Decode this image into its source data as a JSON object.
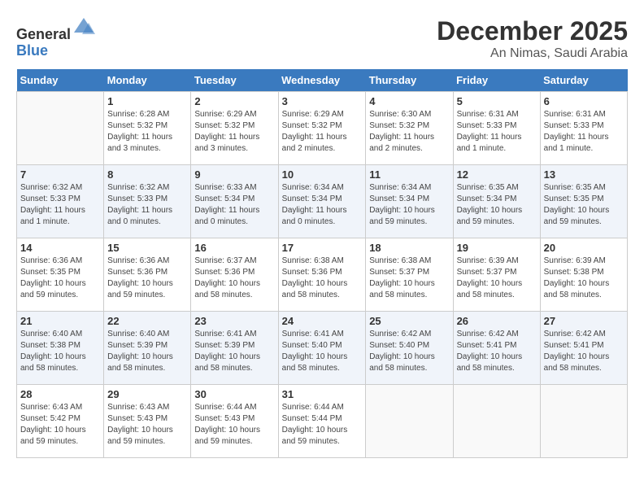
{
  "header": {
    "logo_general": "General",
    "logo_blue": "Blue",
    "month": "December 2025",
    "location": "An Nimas, Saudi Arabia"
  },
  "weekdays": [
    "Sunday",
    "Monday",
    "Tuesday",
    "Wednesday",
    "Thursday",
    "Friday",
    "Saturday"
  ],
  "weeks": [
    [
      {
        "day": "",
        "info": ""
      },
      {
        "day": "1",
        "info": "Sunrise: 6:28 AM\nSunset: 5:32 PM\nDaylight: 11 hours\nand 3 minutes."
      },
      {
        "day": "2",
        "info": "Sunrise: 6:29 AM\nSunset: 5:32 PM\nDaylight: 11 hours\nand 3 minutes."
      },
      {
        "day": "3",
        "info": "Sunrise: 6:29 AM\nSunset: 5:32 PM\nDaylight: 11 hours\nand 2 minutes."
      },
      {
        "day": "4",
        "info": "Sunrise: 6:30 AM\nSunset: 5:32 PM\nDaylight: 11 hours\nand 2 minutes."
      },
      {
        "day": "5",
        "info": "Sunrise: 6:31 AM\nSunset: 5:33 PM\nDaylight: 11 hours\nand 1 minute."
      },
      {
        "day": "6",
        "info": "Sunrise: 6:31 AM\nSunset: 5:33 PM\nDaylight: 11 hours\nand 1 minute."
      }
    ],
    [
      {
        "day": "7",
        "info": "Sunrise: 6:32 AM\nSunset: 5:33 PM\nDaylight: 11 hours\nand 1 minute."
      },
      {
        "day": "8",
        "info": "Sunrise: 6:32 AM\nSunset: 5:33 PM\nDaylight: 11 hours\nand 0 minutes."
      },
      {
        "day": "9",
        "info": "Sunrise: 6:33 AM\nSunset: 5:34 PM\nDaylight: 11 hours\nand 0 minutes."
      },
      {
        "day": "10",
        "info": "Sunrise: 6:34 AM\nSunset: 5:34 PM\nDaylight: 11 hours\nand 0 minutes."
      },
      {
        "day": "11",
        "info": "Sunrise: 6:34 AM\nSunset: 5:34 PM\nDaylight: 10 hours\nand 59 minutes."
      },
      {
        "day": "12",
        "info": "Sunrise: 6:35 AM\nSunset: 5:34 PM\nDaylight: 10 hours\nand 59 minutes."
      },
      {
        "day": "13",
        "info": "Sunrise: 6:35 AM\nSunset: 5:35 PM\nDaylight: 10 hours\nand 59 minutes."
      }
    ],
    [
      {
        "day": "14",
        "info": "Sunrise: 6:36 AM\nSunset: 5:35 PM\nDaylight: 10 hours\nand 59 minutes."
      },
      {
        "day": "15",
        "info": "Sunrise: 6:36 AM\nSunset: 5:36 PM\nDaylight: 10 hours\nand 59 minutes."
      },
      {
        "day": "16",
        "info": "Sunrise: 6:37 AM\nSunset: 5:36 PM\nDaylight: 10 hours\nand 58 minutes."
      },
      {
        "day": "17",
        "info": "Sunrise: 6:38 AM\nSunset: 5:36 PM\nDaylight: 10 hours\nand 58 minutes."
      },
      {
        "day": "18",
        "info": "Sunrise: 6:38 AM\nSunset: 5:37 PM\nDaylight: 10 hours\nand 58 minutes."
      },
      {
        "day": "19",
        "info": "Sunrise: 6:39 AM\nSunset: 5:37 PM\nDaylight: 10 hours\nand 58 minutes."
      },
      {
        "day": "20",
        "info": "Sunrise: 6:39 AM\nSunset: 5:38 PM\nDaylight: 10 hours\nand 58 minutes."
      }
    ],
    [
      {
        "day": "21",
        "info": "Sunrise: 6:40 AM\nSunset: 5:38 PM\nDaylight: 10 hours\nand 58 minutes."
      },
      {
        "day": "22",
        "info": "Sunrise: 6:40 AM\nSunset: 5:39 PM\nDaylight: 10 hours\nand 58 minutes."
      },
      {
        "day": "23",
        "info": "Sunrise: 6:41 AM\nSunset: 5:39 PM\nDaylight: 10 hours\nand 58 minutes."
      },
      {
        "day": "24",
        "info": "Sunrise: 6:41 AM\nSunset: 5:40 PM\nDaylight: 10 hours\nand 58 minutes."
      },
      {
        "day": "25",
        "info": "Sunrise: 6:42 AM\nSunset: 5:40 PM\nDaylight: 10 hours\nand 58 minutes."
      },
      {
        "day": "26",
        "info": "Sunrise: 6:42 AM\nSunset: 5:41 PM\nDaylight: 10 hours\nand 58 minutes."
      },
      {
        "day": "27",
        "info": "Sunrise: 6:42 AM\nSunset: 5:41 PM\nDaylight: 10 hours\nand 58 minutes."
      }
    ],
    [
      {
        "day": "28",
        "info": "Sunrise: 6:43 AM\nSunset: 5:42 PM\nDaylight: 10 hours\nand 59 minutes."
      },
      {
        "day": "29",
        "info": "Sunrise: 6:43 AM\nSunset: 5:43 PM\nDaylight: 10 hours\nand 59 minutes."
      },
      {
        "day": "30",
        "info": "Sunrise: 6:44 AM\nSunset: 5:43 PM\nDaylight: 10 hours\nand 59 minutes."
      },
      {
        "day": "31",
        "info": "Sunrise: 6:44 AM\nSunset: 5:44 PM\nDaylight: 10 hours\nand 59 minutes."
      },
      {
        "day": "",
        "info": ""
      },
      {
        "day": "",
        "info": ""
      },
      {
        "day": "",
        "info": ""
      }
    ]
  ]
}
